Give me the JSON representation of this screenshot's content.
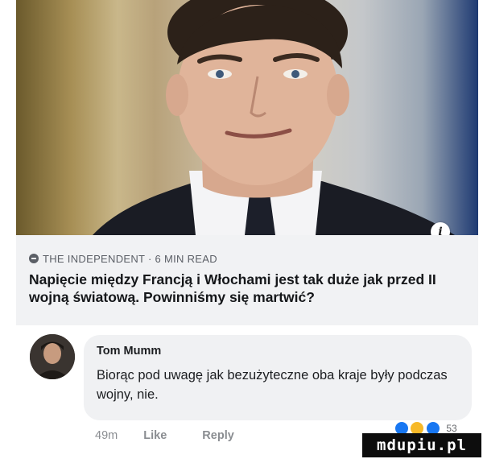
{
  "post": {
    "photo_alt": "portrait photo",
    "info_icon": "i",
    "source_line": "THE INDEPENDENT · 6 MIN READ",
    "headline": "Napięcie między Francją i Włochami jest tak duże jak przed II wojną światową. Powinniśmy się martwić?"
  },
  "comment": {
    "author": "Tom Mumm",
    "text": "Biorąc pod uwagę jak bezużyteczne oba kraje były podczas wojny, nie.",
    "time": "49m",
    "like_label": "Like",
    "reply_label": "Reply",
    "reaction_count": "53",
    "reaction_icons": [
      "like-icon",
      "haha-icon",
      "sad-icon"
    ]
  },
  "watermark": "mdupiu.pl",
  "colors": {
    "card_bg": "#f1f2f4",
    "bubble_bg": "#f0f1f3",
    "like_blue": "#1877f2",
    "meta_gray": "#8a8d91"
  }
}
